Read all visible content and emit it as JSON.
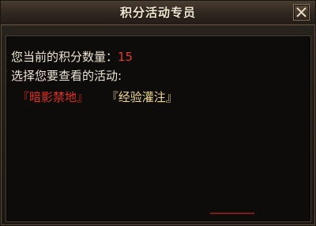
{
  "window": {
    "title": "积分活动专员"
  },
  "content": {
    "points_label": "您当前的积分数量：",
    "points_value": "15",
    "select_prompt": "选择您要查看的活动:",
    "activities": [
      {
        "label": "『暗影禁地』",
        "color": "#e0301f"
      },
      {
        "label": "『经验灌注』",
        "color": "#f0d78f"
      }
    ]
  },
  "icons": {
    "close": "close-icon"
  }
}
